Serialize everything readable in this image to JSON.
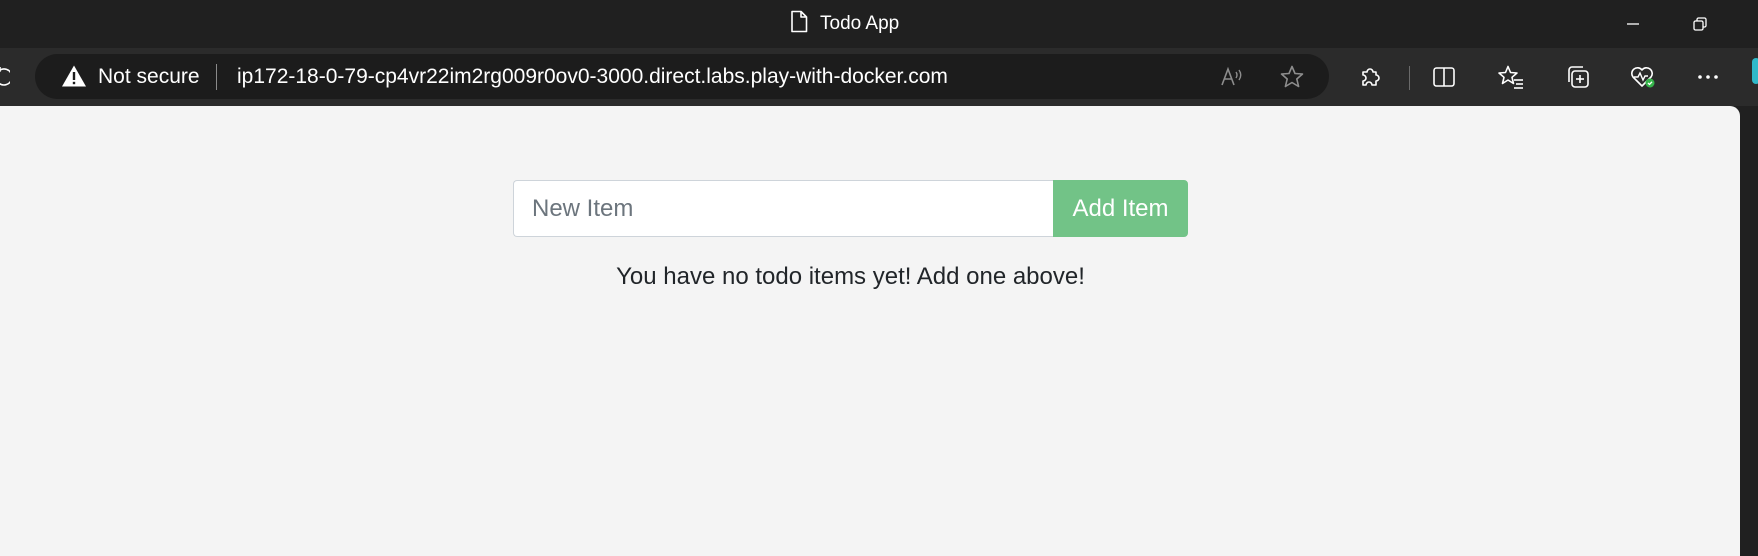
{
  "window": {
    "title": "Todo App",
    "minimize_icon": "minimize-icon",
    "restore_icon": "restore-icon"
  },
  "addressbar": {
    "security_label": "Not secure",
    "url": "ip172-18-0-79-cp4vr22im2rg009r0ov0-3000.direct.labs.play-with-docker.com"
  },
  "toolbar": {
    "icons": [
      "read-aloud-icon",
      "favorite-star-icon",
      "extensions-icon",
      "split-screen-icon",
      "favorites-icon",
      "collections-icon",
      "browser-essentials-icon",
      "more-icon"
    ]
  },
  "app": {
    "input_placeholder": "New Item",
    "input_value": "",
    "add_button_label": "Add Item",
    "empty_message": "You have no todo items yet! Add one above!",
    "accent_color": "#72c387"
  }
}
